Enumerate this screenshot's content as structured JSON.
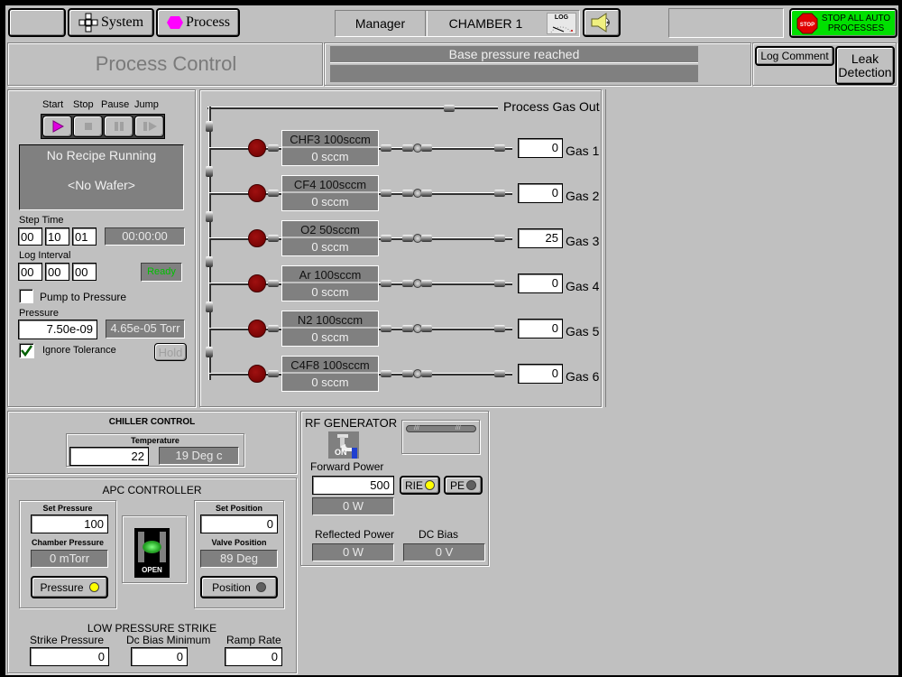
{
  "topbar": {
    "blank_button": "",
    "system_label": "System",
    "process_label": "Process",
    "user_role": "Manager",
    "chamber": "CHAMBER 1",
    "log_icon_label": "LOG",
    "stop_icon_label": "STOP",
    "stop_all_label_1": "STOP ALL AUTO",
    "stop_all_label_2": "PROCESSES"
  },
  "header": {
    "title": "Process Control",
    "status_line_1": "Base pressure reached",
    "status_line_2": "",
    "log_comment_label": "Log Comment",
    "leak_detection_label_1": "Leak",
    "leak_detection_label_2": "Detection"
  },
  "recipe": {
    "start_label": "Start",
    "stop_label": "Stop",
    "pause_label": "Pause",
    "jump_label": "Jump",
    "recipe_status": "No Recipe Running",
    "wafer_status": "<No Wafer>",
    "step_time_label": "Step Time",
    "step_time": [
      "00",
      "10",
      "01"
    ],
    "step_elapsed": "00:00:00",
    "log_interval_label": "Log Interval",
    "log_interval": [
      "00",
      "00",
      "00"
    ],
    "ready_label": "Ready",
    "pump_to_pressure_label": "Pump to Pressure",
    "pump_to_pressure_checked": false,
    "pressure_label": "Pressure",
    "pressure_setpoint": "7.50e-09",
    "pressure_reading": "4.65e-05 Torr",
    "ignore_tolerance_label": "Ignore Tolerance",
    "ignore_tolerance_checked": true,
    "hold_label": "Hold"
  },
  "gas": {
    "out_label": "Process Gas Out",
    "lines": [
      {
        "name": "CHF3 100sccm",
        "flow": "0 sccm",
        "setpoint": "0",
        "label": "Gas 1"
      },
      {
        "name": "CF4 100sccm",
        "flow": "0 sccm",
        "setpoint": "0",
        "label": "Gas 2"
      },
      {
        "name": "O2 50sccm",
        "flow": "0 sccm",
        "setpoint": "25",
        "label": "Gas 3"
      },
      {
        "name": "Ar 100sccm",
        "flow": "0 sccm",
        "setpoint": "0",
        "label": "Gas 4"
      },
      {
        "name": "N2 100sccm",
        "flow": "0 sccm",
        "setpoint": "0",
        "label": "Gas 5"
      },
      {
        "name": "C4F8 100sccm",
        "flow": "0 sccm",
        "setpoint": "0",
        "label": "Gas 6"
      }
    ]
  },
  "chiller": {
    "title": "CHILLER CONTROL",
    "temperature_label": "Temperature",
    "setpoint": "22",
    "reading": "19 Deg c"
  },
  "apc": {
    "title": "APC CONTROLLER",
    "set_pressure_label": "Set Pressure",
    "set_pressure": "100",
    "chamber_pressure_label": "Chamber Pressure",
    "chamber_pressure": "0 mTorr",
    "pressure_button": "Pressure",
    "valve_state": "OPEN",
    "set_position_label": "Set Position",
    "set_position": "0",
    "valve_position_label": "Valve Position",
    "valve_position": "89 Deg",
    "position_button": "Position",
    "strike_title": "LOW PRESSURE STRIKE",
    "strike_pressure_label": "Strike Pressure",
    "strike_pressure": "0",
    "dc_bias_min_label": "Dc Bias Minimum",
    "dc_bias_min": "0",
    "ramp_rate_label": "Ramp Rate",
    "ramp_rate": "0"
  },
  "rf": {
    "title": "RF  GENERATOR",
    "on_label": "ON",
    "forward_power_label": "Forward Power",
    "forward_setpoint": "500",
    "forward_reading": "0 W",
    "rie_label": "RIE",
    "pe_label": "PE",
    "reflected_power_label": "Reflected Power",
    "reflected_reading": "0 W",
    "dc_bias_label": "DC Bias",
    "dc_bias_reading": "0 V"
  },
  "colors": {
    "stop_all_green": "#00e000",
    "process_magenta": "#ff00ff",
    "valve_red": "#8b0000",
    "indicator_yellow": "#ffff00",
    "ready_green": "#00c000"
  }
}
